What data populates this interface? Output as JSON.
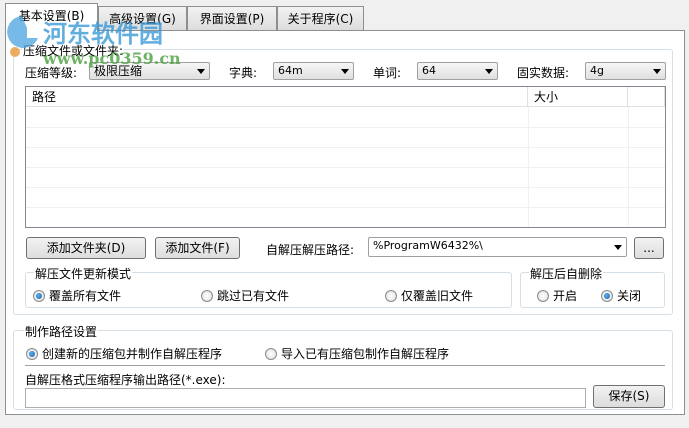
{
  "tabs": [
    {
      "label": "基本设置(B)"
    },
    {
      "label": "高级设置(G)"
    },
    {
      "label": "界面设置(P)"
    },
    {
      "label": "关于程序(C)"
    }
  ],
  "watermark": {
    "name": "河东软件园",
    "url": "www.pc0359.cn"
  },
  "files_group": {
    "label": "压缩文件或文件夹:"
  },
  "level": {
    "label": "压缩等级:",
    "value": "极限压缩"
  },
  "dict": {
    "label": "字典:",
    "value": "64m"
  },
  "word": {
    "label": "单词:",
    "value": "64"
  },
  "solid": {
    "label": "固实数据:",
    "value": "4g"
  },
  "list": {
    "columns": [
      "路径",
      "大小"
    ]
  },
  "buttons": {
    "add_folder": "添加文件夹(D)",
    "add_file": "添加文件(F)",
    "browse": "...",
    "save": "保存(S)"
  },
  "extract_path": {
    "label": "自解压解压路径:",
    "value": "%ProgramW6432%\\"
  },
  "update_mode": {
    "label": "解压文件更新模式",
    "options": [
      "覆盖所有文件",
      "跳过已有文件",
      "仅覆盖旧文件"
    ]
  },
  "auto_delete": {
    "label": "解压后自删除",
    "options": [
      "开启",
      "关闭"
    ]
  },
  "make_path": {
    "label": "制作路径设置",
    "options": [
      "创建新的压缩包并制作自解压程序",
      "导入已有压缩包制作自解压程序"
    ]
  },
  "output": {
    "label": "自解压格式压缩程序输出路径(*.exe):",
    "value": ""
  }
}
